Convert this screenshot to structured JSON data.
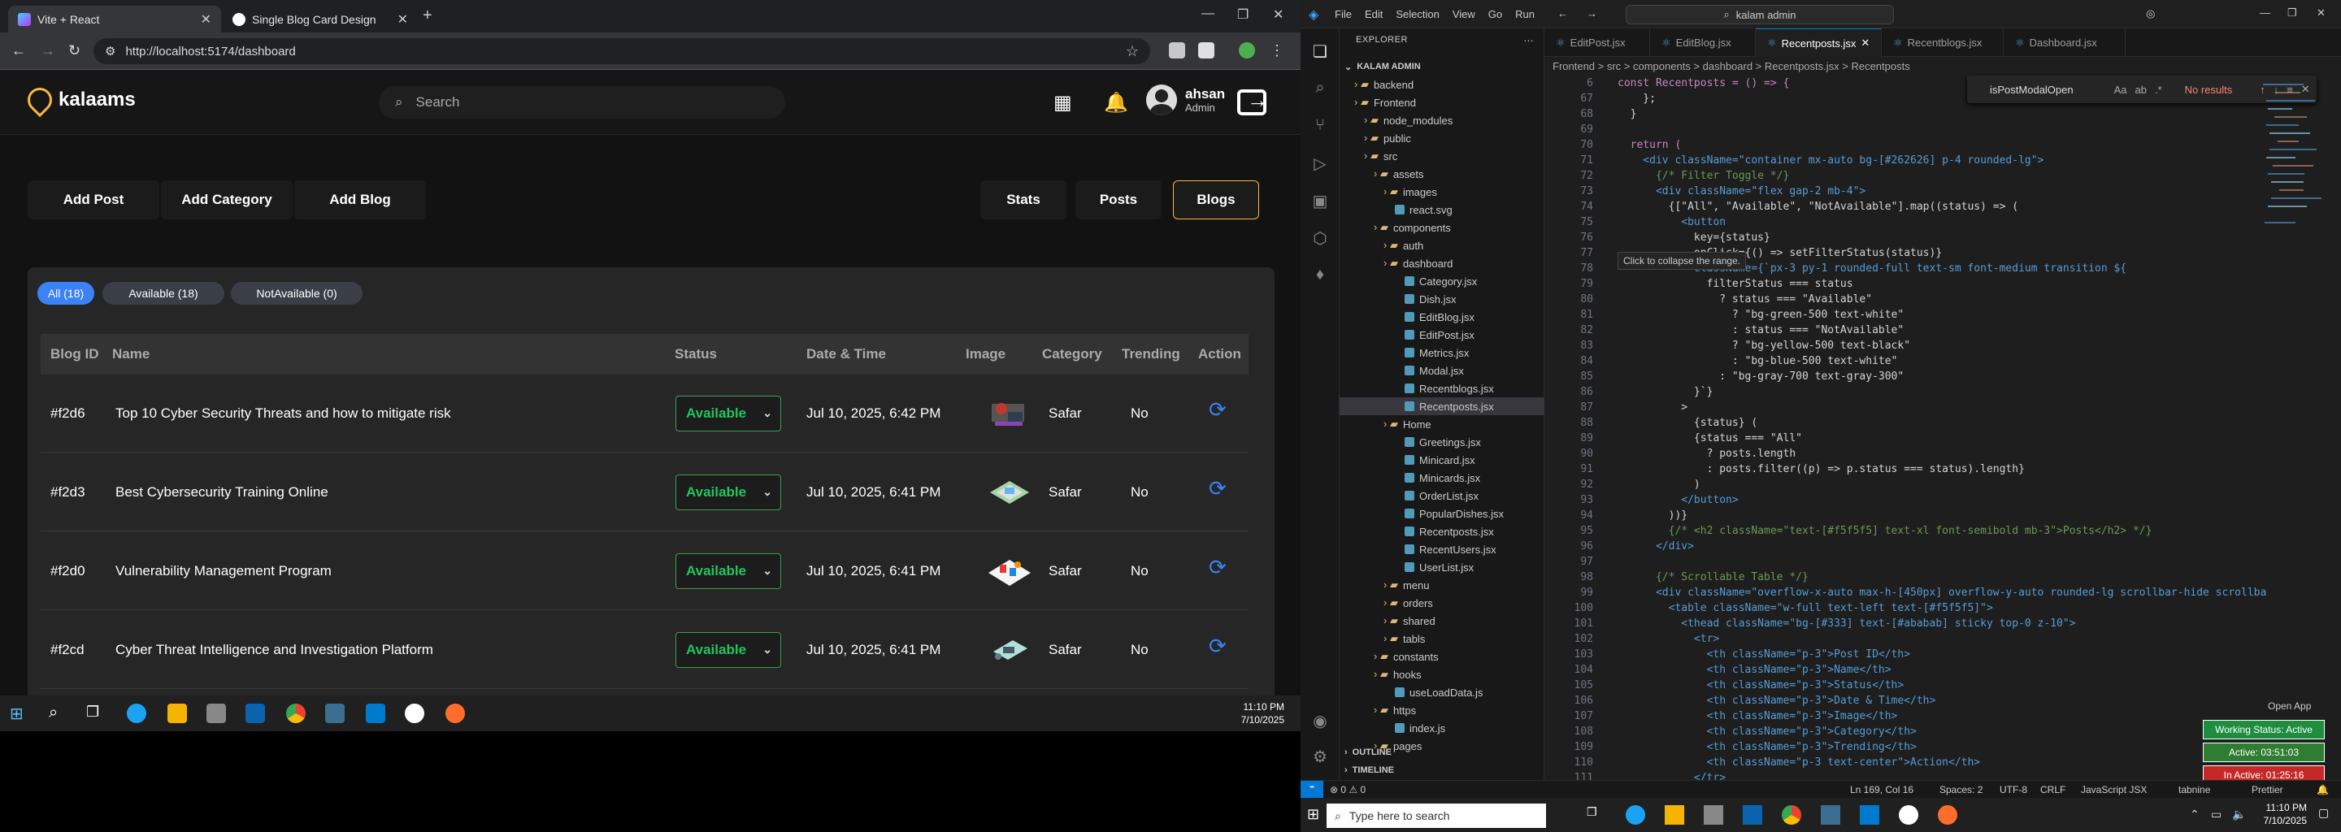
{
  "browser": {
    "tabs": [
      {
        "label": "Vite + React",
        "close": "✕"
      },
      {
        "label": "Single Blog Card Design",
        "close": "✕"
      }
    ],
    "new_tab": "+",
    "window_controls": [
      "—",
      "❐",
      "✕"
    ],
    "url": "http://localhost:5174/dashboard",
    "nav": {
      "back": "←",
      "forward": "→",
      "reload": "↻"
    }
  },
  "app": {
    "logo_text": "kalaams",
    "search_placeholder": "Search",
    "user": {
      "name": "ahsan",
      "role": "Admin"
    },
    "actions": [
      "Add Post",
      "Add Category",
      "Add Blog"
    ],
    "views": [
      "Stats",
      "Posts",
      "Blogs"
    ],
    "active_view": "Blogs",
    "filters": [
      {
        "label": "All (18)",
        "selected": true
      },
      {
        "label": "Available (18)",
        "selected": false
      },
      {
        "label": "NotAvailable (0)",
        "selected": false
      }
    ],
    "table": {
      "headers": [
        "Blog ID",
        "Name",
        "Status",
        "Date & Time",
        "Image",
        "Category",
        "Trending",
        "Action"
      ],
      "rows": [
        {
          "id": "#f2d6",
          "name": "Top 10 Cyber Security Threats and how to mitigate risk",
          "status": "Available",
          "date": "Jul 10, 2025, 6:42 PM",
          "category": "Safar",
          "trending": "No"
        },
        {
          "id": "#f2d3",
          "name": "Best Cybersecurity Training Online",
          "status": "Available",
          "date": "Jul 10, 2025, 6:41 PM",
          "category": "Safar",
          "trending": "No"
        },
        {
          "id": "#f2d0",
          "name": "Vulnerability Management Program",
          "status": "Available",
          "date": "Jul 10, 2025, 6:41 PM",
          "category": "Safar",
          "trending": "No"
        },
        {
          "id": "#f2cd",
          "name": "Cyber Threat Intelligence and Investigation Platform",
          "status": "Available",
          "date": "Jul 10, 2025, 6:41 PM",
          "category": "Safar",
          "trending": "No"
        }
      ]
    }
  },
  "taskbar_left": {
    "time": "11:10 PM",
    "date": "7/10/2025"
  },
  "vscode": {
    "menu": [
      "File",
      "Edit",
      "Selection",
      "View",
      "Go",
      "Run"
    ],
    "command_center": "kalam admin",
    "explorer_title": "EXPLORER",
    "root": "KALAM ADMIN",
    "tree": [
      {
        "label": "backend",
        "indent": 1,
        "folder": true
      },
      {
        "label": "Frontend",
        "indent": 1,
        "folder": true
      },
      {
        "label": "node_modules",
        "indent": 2,
        "folder": true
      },
      {
        "label": "public",
        "indent": 2,
        "folder": true
      },
      {
        "label": "src",
        "indent": 2,
        "folder": true
      },
      {
        "label": "assets",
        "indent": 3,
        "folder": true
      },
      {
        "label": "images",
        "indent": 4,
        "folder": true
      },
      {
        "label": "react.svg",
        "indent": 4,
        "folder": false
      },
      {
        "label": "components",
        "indent": 3,
        "folder": true
      },
      {
        "label": "auth",
        "indent": 4,
        "folder": true
      },
      {
        "label": "dashboard",
        "indent": 4,
        "folder": true
      },
      {
        "label": "Category.jsx",
        "indent": 5,
        "folder": false
      },
      {
        "label": "Dish.jsx",
        "indent": 5,
        "folder": false
      },
      {
        "label": "EditBlog.jsx",
        "indent": 5,
        "folder": false
      },
      {
        "label": "EditPost.jsx",
        "indent": 5,
        "folder": false
      },
      {
        "label": "Metrics.jsx",
        "indent": 5,
        "folder": false
      },
      {
        "label": "Modal.jsx",
        "indent": 5,
        "folder": false
      },
      {
        "label": "Recentblogs.jsx",
        "indent": 5,
        "folder": false
      },
      {
        "label": "Recentposts.jsx",
        "indent": 5,
        "folder": false,
        "selected": true
      },
      {
        "label": "Home",
        "indent": 4,
        "folder": true
      },
      {
        "label": "Greetings.jsx",
        "indent": 5,
        "folder": false
      },
      {
        "label": "Minicard.jsx",
        "indent": 5,
        "folder": false
      },
      {
        "label": "Minicards.jsx",
        "indent": 5,
        "folder": false
      },
      {
        "label": "OrderList.jsx",
        "indent": 5,
        "folder": false
      },
      {
        "label": "PopularDishes.jsx",
        "indent": 5,
        "folder": false
      },
      {
        "label": "Recentposts.jsx",
        "indent": 5,
        "folder": false
      },
      {
        "label": "RecentUsers.jsx",
        "indent": 5,
        "folder": false
      },
      {
        "label": "UserList.jsx",
        "indent": 5,
        "folder": false
      },
      {
        "label": "menu",
        "indent": 4,
        "folder": true
      },
      {
        "label": "orders",
        "indent": 4,
        "folder": true
      },
      {
        "label": "shared",
        "indent": 4,
        "folder": true
      },
      {
        "label": "tabls",
        "indent": 4,
        "folder": true
      },
      {
        "label": "constants",
        "indent": 3,
        "folder": true
      },
      {
        "label": "hooks",
        "indent": 3,
        "folder": true
      },
      {
        "label": "useLoadData.js",
        "indent": 4,
        "folder": false
      },
      {
        "label": "https",
        "indent": 3,
        "folder": true
      },
      {
        "label": "index.js",
        "indent": 4,
        "folder": false
      },
      {
        "label": "pages",
        "indent": 3,
        "folder": true
      }
    ],
    "outline": "OUTLINE",
    "timeline": "TIMELINE",
    "tabs": [
      "EditPost.jsx",
      "EditBlog.jsx",
      "Recentposts.jsx",
      "Recentblogs.jsx",
      "Dashboard.jsx"
    ],
    "active_tab": "Recentposts.jsx",
    "breadcrumb": "Frontend > src > components > dashboard > Recentposts.jsx > Recentposts",
    "find": {
      "query": "isPostModalOpen",
      "result": "No results"
    },
    "tooltip": "Click to collapse the range.",
    "code_lines": [
      {
        "n": "6",
        "t": "const Recentposts = () => {"
      },
      {
        "n": "67",
        "t": "    };"
      },
      {
        "n": "68",
        "t": "  }"
      },
      {
        "n": "69",
        "t": ""
      },
      {
        "n": "70",
        "t": "  return ("
      },
      {
        "n": "71",
        "t": "    <div className=\"container mx-auto bg-[#262626] p-4 rounded-lg\">"
      },
      {
        "n": "72",
        "t": "      {/* Filter Toggle */}"
      },
      {
        "n": "73",
        "t": "      <div className=\"flex gap-2 mb-4\">"
      },
      {
        "n": "74",
        "t": "        {[\"All\", \"Available\", \"NotAvailable\"].map((status) => ("
      },
      {
        "n": "75",
        "t": "          <button"
      },
      {
        "n": "76",
        "t": "            key={status}"
      },
      {
        "n": "77",
        "t": "            onClick={() => setFilterStatus(status)}"
      },
      {
        "n": "78",
        "t": "            className={`px-3 py-1 rounded-full text-sm font-medium transition ${"
      },
      {
        "n": "79",
        "t": "              filterStatus === status"
      },
      {
        "n": "80",
        "t": "                ? status === \"Available\""
      },
      {
        "n": "81",
        "t": "                  ? \"bg-green-500 text-white\""
      },
      {
        "n": "82",
        "t": "                  : status === \"NotAvailable\""
      },
      {
        "n": "83",
        "t": "                  ? \"bg-yellow-500 text-black\""
      },
      {
        "n": "84",
        "t": "                  : \"bg-blue-500 text-white\""
      },
      {
        "n": "85",
        "t": "                : \"bg-gray-700 text-gray-300\""
      },
      {
        "n": "86",
        "t": "            }`}"
      },
      {
        "n": "87",
        "t": "          >"
      },
      {
        "n": "88",
        "t": "            {status} ("
      },
      {
        "n": "89",
        "t": "            {status === \"All\""
      },
      {
        "n": "90",
        "t": "              ? posts.length"
      },
      {
        "n": "91",
        "t": "              : posts.filter((p) => p.status === status).length}"
      },
      {
        "n": "92",
        "t": "            )"
      },
      {
        "n": "93",
        "t": "          </button>"
      },
      {
        "n": "94",
        "t": "        ))}"
      },
      {
        "n": "95",
        "t": "        {/* <h2 className=\"text-[#f5f5f5] text-xl font-semibold mb-3\">Posts</h2> */}"
      },
      {
        "n": "96",
        "t": "      </div>"
      },
      {
        "n": "97",
        "t": ""
      },
      {
        "n": "98",
        "t": "      {/* Scrollable Table */}"
      },
      {
        "n": "99",
        "t": "      <div className=\"overflow-x-auto max-h-[450px] overflow-y-auto rounded-lg scrollbar-hide scrollba"
      },
      {
        "n": "100",
        "t": "        <table className=\"w-full text-left text-[#f5f5f5]\">"
      },
      {
        "n": "101",
        "t": "          <thead className=\"bg-[#333] text-[#ababab] sticky top-0 z-10\">"
      },
      {
        "n": "102",
        "t": "            <tr>"
      },
      {
        "n": "103",
        "t": "              <th className=\"p-3\">Post ID</th>"
      },
      {
        "n": "104",
        "t": "              <th className=\"p-3\">Name</th>"
      },
      {
        "n": "105",
        "t": "              <th className=\"p-3\">Status</th>"
      },
      {
        "n": "106",
        "t": "              <th className=\"p-3\">Date & Time</th>"
      },
      {
        "n": "107",
        "t": "              <th className=\"p-3\">Image</th>"
      },
      {
        "n": "108",
        "t": "              <th className=\"p-3\">Category</th>"
      },
      {
        "n": "109",
        "t": "              <th className=\"p-3\">Trending</th>"
      },
      {
        "n": "110",
        "t": "              <th className=\"p-3 text-center\">Action</th>"
      },
      {
        "n": "111",
        "t": "            </tr>"
      }
    ],
    "status": {
      "errors": "⊗ 0 ⚠ 0",
      "position": "Ln 169, Col 16",
      "spaces": "Spaces: 2",
      "encoding": "UTF-8",
      "eol": "CRLF",
      "language": "JavaScript JSX",
      "extension": "tabnine",
      "prettier": "Prettier"
    },
    "open_app": "Open App",
    "working_status": "Working Status: Active",
    "active_time": "Active: 03:51:03",
    "inactive_time": "In Active: 01:25:16",
    "colors": {
      "working": "#1e8e3e",
      "active": "#2e7d32",
      "inactive": "#c62828"
    }
  },
  "taskbar_right": {
    "search": "Type here to search",
    "time": "11:10 PM",
    "date": "7/10/2025"
  },
  "colors": {
    "accent": "#3b82f6",
    "brand": "#f6b73c",
    "available": "#22c55e",
    "vscode_blue": "#0078d4"
  }
}
